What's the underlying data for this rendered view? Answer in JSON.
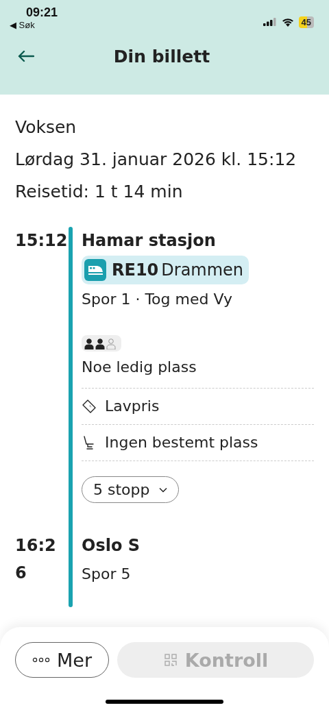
{
  "status_bar": {
    "time": "09:21",
    "back_link": "◀ Søk",
    "battery": "45",
    "low_power": true
  },
  "header": {
    "title": "Din billett"
  },
  "ticket": {
    "passenger": "Voksen",
    "date": "Lørdag 31. januar 2026 kl. 15:12",
    "duration": "Reisetid: 1 t 14 min"
  },
  "departure": {
    "time": "15:12",
    "station": "Hamar stasjon",
    "line": "RE10",
    "destination": "Drammen",
    "platform": "Spor 1 · Tog med Vy",
    "occupancy": [
      {
        "filled": true
      },
      {
        "filled": true
      },
      {
        "filled": false
      }
    ],
    "occupancy_label": "Noe ledig plass",
    "features": [
      {
        "kind": "ticket",
        "label": "Lavpris"
      },
      {
        "kind": "seat",
        "label": "Ingen bestemt plass"
      }
    ],
    "stops_button": "5 stopp",
    "stops_expanded": false
  },
  "arrival": {
    "time": "16:26",
    "station": "Oslo S",
    "platform": "Spor 5"
  },
  "actions": [
    {
      "kind": "more",
      "label": "Mer",
      "disabled": false
    },
    {
      "kind": "qr",
      "label": "Kontroll",
      "disabled": true
    }
  ]
}
